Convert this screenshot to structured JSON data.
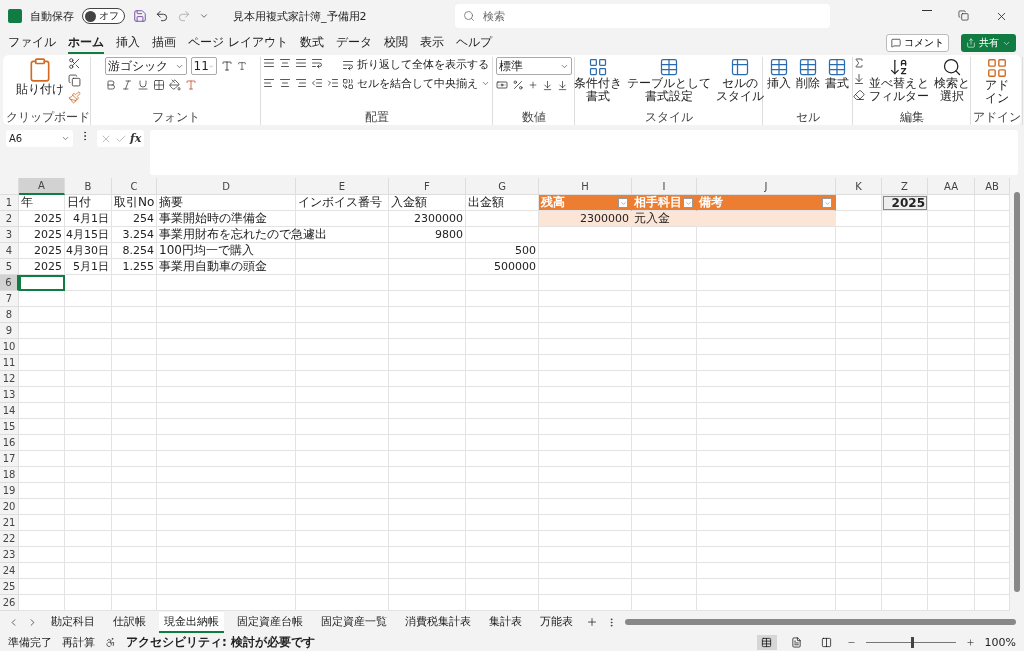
{
  "title_bar": {
    "autosave_label": "自動保存",
    "autosave_toggle": {
      "label": "オフ",
      "on": false
    },
    "document_title": "見本用複式家計簿_予備用2",
    "search": {
      "placeholder": "検索"
    }
  },
  "menu_tabs": [
    {
      "label": "ファイル",
      "selected": false
    },
    {
      "label": "ホーム",
      "selected": true
    },
    {
      "label": "挿入",
      "selected": false
    },
    {
      "label": "描画",
      "selected": false
    },
    {
      "label": "ページ レイアウト",
      "selected": false
    },
    {
      "label": "数式",
      "selected": false
    },
    {
      "label": "データ",
      "selected": false
    },
    {
      "label": "校閲",
      "selected": false
    },
    {
      "label": "表示",
      "selected": false
    },
    {
      "label": "ヘルプ",
      "selected": false
    }
  ],
  "header_actions": {
    "comment": "コメント",
    "share": "共有"
  },
  "ribbon": [
    {
      "kind": "clipboard",
      "label": "クリップボード",
      "buttons": [
        {
          "lines": [
            "貼り付け"
          ]
        }
      ]
    },
    {
      "kind": "font",
      "label": "フォント",
      "font_name": "游ゴシック",
      "font_size": "11"
    },
    {
      "kind": "alignment",
      "label": "配置",
      "buttons": [
        {
          "lines": [
            "折り返して全体を表示する"
          ]
        },
        {
          "lines": [
            "セルを結合して中央揃え"
          ]
        }
      ]
    },
    {
      "kind": "number",
      "label": "数値",
      "format": "標準"
    },
    {
      "kind": "styles",
      "label": "スタイル",
      "buttons": [
        {
          "lines": [
            "条件付き",
            "書式"
          ]
        },
        {
          "lines": [
            "テーブルとして",
            "書式設定"
          ]
        },
        {
          "lines": [
            "セルの",
            "スタイル"
          ]
        }
      ]
    },
    {
      "kind": "cells",
      "label": "セル",
      "buttons": [
        {
          "lines": [
            "挿入"
          ]
        },
        {
          "lines": [
            "削除"
          ]
        },
        {
          "lines": [
            "書式"
          ]
        }
      ]
    },
    {
      "kind": "editing",
      "label": "編集",
      "buttons": [
        {
          "lines": [
            "並べ替えと",
            "フィルター"
          ]
        },
        {
          "lines": [
            "検索と",
            "選択"
          ]
        }
      ]
    },
    {
      "kind": "addins",
      "label": "アドイン",
      "buttons": [
        {
          "lines": [
            "アド",
            "イン"
          ]
        }
      ]
    }
  ],
  "formula_bar": {
    "name_box": "A6",
    "function_label": "fx"
  },
  "sheet": {
    "columns": [
      {
        "label": "A",
        "selected": true
      },
      {
        "label": "B",
        "selected": false
      },
      {
        "label": "C",
        "selected": false
      },
      {
        "label": "D",
        "selected": false
      },
      {
        "label": "E",
        "selected": false
      },
      {
        "label": "F",
        "selected": false
      },
      {
        "label": "G",
        "selected": false
      },
      {
        "label": "H",
        "selected": false
      },
      {
        "label": "I",
        "selected": false
      },
      {
        "label": "J",
        "selected": false
      },
      {
        "label": "K",
        "selected": false
      },
      {
        "label": "Z",
        "selected": false
      },
      {
        "label": "AA",
        "selected": false
      },
      {
        "label": "AB",
        "selected": false
      }
    ],
    "rows": [
      {
        "label": "1",
        "selected": false,
        "cells": [
          {
            "kind": "text",
            "text": "年"
          },
          {
            "kind": "text",
            "text": "日付"
          },
          {
            "kind": "text",
            "text": "取引No"
          },
          {
            "kind": "text",
            "text": "摘要"
          },
          {
            "kind": "text",
            "text": "インボイス番号"
          },
          {
            "kind": "text",
            "text": "入金額"
          },
          {
            "kind": "text",
            "text": "出金額"
          },
          {
            "kind": "table_header",
            "text": "残高"
          },
          {
            "kind": "table_header",
            "text": "相手科目"
          },
          {
            "kind": "table_header",
            "text": "備考"
          },
          null,
          {
            "kind": "boxed",
            "text": "2025"
          },
          null,
          null
        ]
      },
      {
        "label": "2",
        "selected": false,
        "cells": [
          {
            "kind": "number",
            "text": "2025"
          },
          {
            "kind": "number",
            "text": "4月1日"
          },
          {
            "kind": "number",
            "text": "254"
          },
          {
            "kind": "text",
            "text": "事業開始時の準備金"
          },
          null,
          {
            "kind": "number",
            "text": "2300000"
          },
          null,
          {
            "kind": "table_number",
            "text": "2300000"
          },
          {
            "kind": "table_text",
            "text": "元入金"
          },
          {
            "kind": "table_text"
          },
          null,
          null,
          null,
          null
        ]
      },
      {
        "label": "3",
        "selected": false,
        "cells": [
          {
            "kind": "number",
            "text": "2025"
          },
          {
            "kind": "number",
            "text": "4月15日"
          },
          {
            "kind": "number",
            "text": "3.254"
          },
          {
            "kind": "text",
            "text": "事業用財布を忘れたので急遽出"
          },
          null,
          {
            "kind": "number",
            "text": "9800"
          },
          null,
          null,
          null,
          null,
          null,
          null,
          null,
          null
        ]
      },
      {
        "label": "4",
        "selected": false,
        "cells": [
          {
            "kind": "number",
            "text": "2025"
          },
          {
            "kind": "number",
            "text": "4月30日"
          },
          {
            "kind": "number",
            "text": "8.254"
          },
          {
            "kind": "text",
            "text": "100円均一で購入"
          },
          null,
          null,
          {
            "kind": "number",
            "text": "500"
          },
          null,
          null,
          null,
          null,
          null,
          null,
          null
        ]
      },
      {
        "label": "5",
        "selected": false,
        "cells": [
          {
            "kind": "number",
            "text": "2025"
          },
          {
            "kind": "number",
            "text": "5月1日"
          },
          {
            "kind": "number",
            "text": "1.255"
          },
          {
            "kind": "text",
            "text": "事業用自動車の頭金"
          },
          null,
          null,
          {
            "kind": "number",
            "text": "500000"
          },
          null,
          null,
          null,
          null,
          null,
          null,
          null
        ]
      },
      {
        "label": "6",
        "selected": true,
        "cells": [
          {
            "kind": "text",
            "selected": true
          }
        ]
      },
      {
        "label": "7",
        "selected": false,
        "cells": []
      },
      {
        "label": "8",
        "selected": false,
        "cells": []
      },
      {
        "label": "9",
        "selected": false,
        "cells": []
      },
      {
        "label": "10",
        "selected": false,
        "cells": []
      },
      {
        "label": "11",
        "selected": false,
        "cells": []
      },
      {
        "label": "12",
        "selected": false,
        "cells": []
      },
      {
        "label": "13",
        "selected": false,
        "cells": []
      },
      {
        "label": "14",
        "selected": false,
        "cells": []
      },
      {
        "label": "15",
        "selected": false,
        "cells": []
      },
      {
        "label": "16",
        "selected": false,
        "cells": []
      },
      {
        "label": "17",
        "selected": false,
        "cells": []
      },
      {
        "label": "18",
        "selected": false,
        "cells": []
      },
      {
        "label": "19",
        "selected": false,
        "cells": []
      },
      {
        "label": "20",
        "selected": false,
        "cells": []
      },
      {
        "label": "21",
        "selected": false,
        "cells": []
      },
      {
        "label": "22",
        "selected": false,
        "cells": []
      },
      {
        "label": "23",
        "selected": false,
        "cells": []
      },
      {
        "label": "24",
        "selected": false,
        "cells": []
      },
      {
        "label": "25",
        "selected": false,
        "cells": []
      },
      {
        "label": "26",
        "selected": false,
        "cells": []
      }
    ]
  },
  "sheet_tabs": [
    {
      "label": "勘定科目",
      "selected": false
    },
    {
      "label": "仕訳帳",
      "selected": false
    },
    {
      "label": "現金出納帳",
      "selected": true
    },
    {
      "label": "固定資産台帳",
      "selected": false
    },
    {
      "label": "固定資産一覧",
      "selected": false
    },
    {
      "label": "消費税集計表",
      "selected": false
    },
    {
      "label": "集計表",
      "selected": false
    },
    {
      "label": "万能表",
      "selected": false
    }
  ],
  "status_bar": {
    "ready": "準備完了",
    "recalc": "再計算",
    "accessibility": "アクセシビリティ: 検討が必要です",
    "view_buttons": [
      {
        "selected": true
      },
      {
        "selected": false
      },
      {
        "selected": false
      }
    ],
    "zoom": {
      "level": 0.5
    },
    "zoom_label": "100%"
  }
}
